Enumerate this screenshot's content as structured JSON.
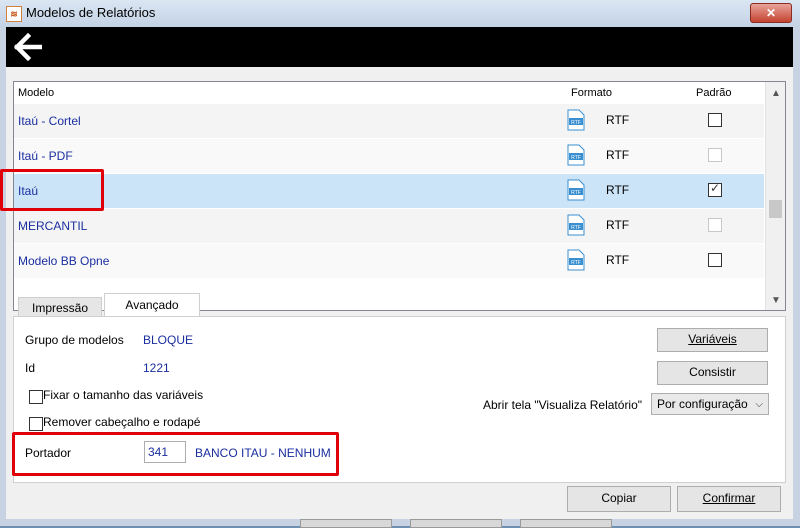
{
  "window": {
    "title": "Modelos de Relatórios",
    "close_icon": "✕"
  },
  "grid": {
    "headers": {
      "modelo": "Modelo",
      "formato": "Formato",
      "padrao": "Padrão"
    },
    "rows": [
      {
        "modelo": "Itaú - Cortel",
        "formato": "RTF",
        "padrao": "unchecked"
      },
      {
        "modelo": "Itaú - PDF",
        "formato": "RTF",
        "padrao": "disabled"
      },
      {
        "modelo": "Itaú",
        "formato": "RTF",
        "padrao": "checked"
      },
      {
        "modelo": "MERCANTIL",
        "formato": "RTF",
        "padrao": "disabled"
      },
      {
        "modelo": "Modelo BB Opne",
        "formato": "RTF",
        "padrao": "unchecked"
      }
    ],
    "rtf_badge": "RTF"
  },
  "tabs": {
    "impressao": "Impressão",
    "avancado": "Avançado"
  },
  "details": {
    "grupo_label": "Grupo de modelos",
    "grupo_value": "BLOQUE",
    "id_label": "Id",
    "id_value": "1221",
    "fixar_label": "Fixar o tamanho das variáveis",
    "remover_label": "Remover cabeçalho e rodapé",
    "portador_label": "Portador",
    "portador_code": "341",
    "portador_name": "BANCO ITAU - NENHUM",
    "variaveis_button": "Variáveis",
    "consistir_button": "Consistir",
    "abrir_label": "Abrir tela \"Visualiza Relatório\"",
    "abrir_select": "Por configuração"
  },
  "footer": {
    "copiar": "Copiar",
    "confirmar": "Confirmar"
  },
  "colors": {
    "highlight": "#e0000a",
    "selected_row": "#cce4f7",
    "link_text": "#1a2ea0"
  }
}
